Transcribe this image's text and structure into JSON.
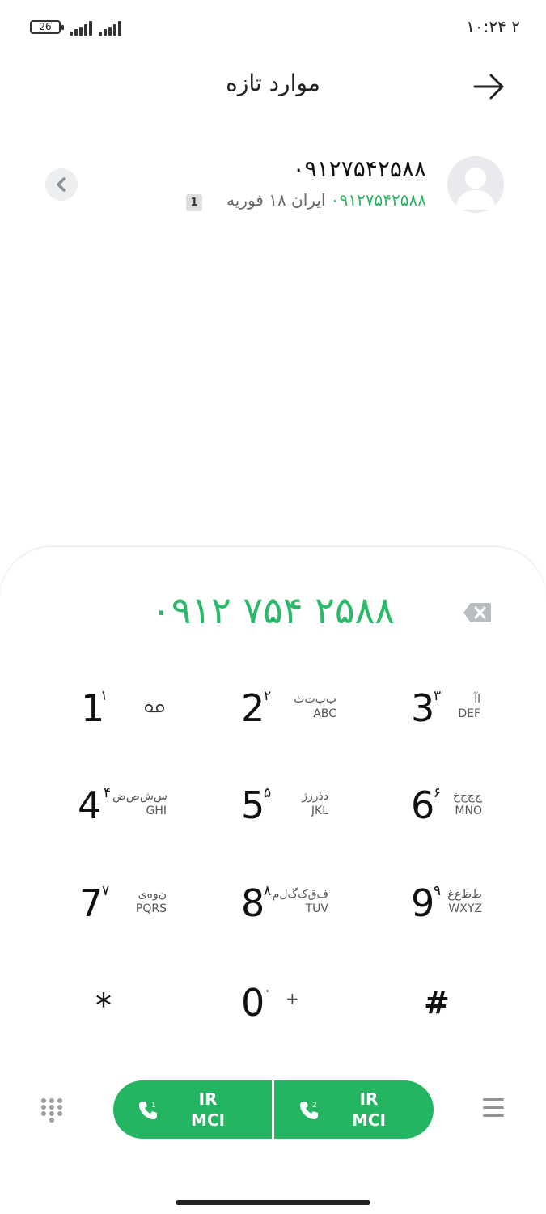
{
  "status_bar": {
    "battery": "26",
    "clock": "۲ ۱۰:۲۴"
  },
  "header": {
    "title": "موارد تازه",
    "back_icon": "arrow-right-icon"
  },
  "recent_call": {
    "number": "۰۹۱۲۷۵۴۲۵۸۸",
    "number_green": "۰۹۱۲۷۵۴۲۵۸۸",
    "detail": "ایران ۱۸ فوریه",
    "sim": "1",
    "avatar_icon": "person-icon",
    "expand_icon": "chevron-left-icon"
  },
  "dialer": {
    "typed_number": "۰۹۱۲ ۷۵۴ ۲۵۸۸",
    "backspace_icon": "backspace-icon",
    "keys": [
      {
        "digit": "1",
        "fa": "۱",
        "per": "",
        "en": "",
        "icon": "voicemail-icon"
      },
      {
        "digit": "2",
        "fa": "۲",
        "per": "ب‌پ‌ت‌ث",
        "en": "ABC"
      },
      {
        "digit": "3",
        "fa": "۳",
        "per": "اآ",
        "en": "DEF"
      },
      {
        "digit": "4",
        "fa": "۴",
        "per": "س‌ش‌ص‌ض",
        "en": "GHI"
      },
      {
        "digit": "5",
        "fa": "۵",
        "per": "دذرزژ",
        "en": "JKL"
      },
      {
        "digit": "6",
        "fa": "۶",
        "per": "ج‌چ‌ح‌خ",
        "en": "MNO"
      },
      {
        "digit": "7",
        "fa": "۷",
        "per": "ن‌و‌ه‌ی",
        "en": "PQRS"
      },
      {
        "digit": "8",
        "fa": "۸",
        "per": "ف‌ق‌ک‌گ‌ل‌م",
        "en": "TUV"
      },
      {
        "digit": "9",
        "fa": "۹",
        "per": "ط‌ظ‌ع‌غ",
        "en": "WXYZ"
      },
      {
        "digit": "*",
        "fa": "",
        "per": "",
        "en": ""
      },
      {
        "digit": "0",
        "fa": "۰",
        "per": "+",
        "en": ""
      },
      {
        "digit": "#",
        "fa": "",
        "per": "",
        "en": ""
      }
    ]
  },
  "call_buttons": [
    {
      "sim": "1",
      "line1": "IR",
      "line2": "MCI"
    },
    {
      "sim": "2",
      "line1": "IR",
      "line2": "MCI"
    }
  ],
  "colors": {
    "accent_green": "#23b561",
    "number_green": "#2bb86a"
  },
  "icons": {
    "keypad": "keypad-grid-icon",
    "menu": "menu-icon"
  }
}
